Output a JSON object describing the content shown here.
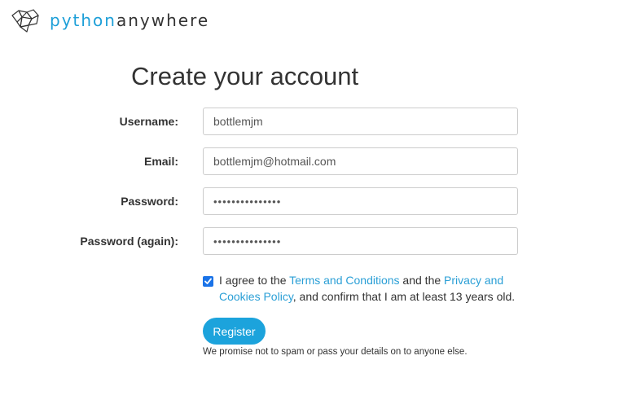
{
  "brand": {
    "name_part1": "python",
    "name_part2": "anywhere",
    "logo_icon": "pythonanywhere-logo-icon",
    "colors": {
      "accent": "#1d9fd8",
      "text": "#333333"
    }
  },
  "page": {
    "title": "Create your account"
  },
  "form": {
    "username": {
      "label": "Username:",
      "value": "bottlemjm"
    },
    "email": {
      "label": "Email:",
      "value": "bottlemjm@hotmail.com"
    },
    "password": {
      "label": "Password:",
      "value": "passwordpasswor"
    },
    "password_again": {
      "label": "Password (again):",
      "value": "passwordpasswor"
    },
    "agree": {
      "checked": true,
      "text_1": "I agree to the ",
      "terms_link": "Terms and Conditions",
      "text_2": " and the ",
      "privacy_link": "Privacy and Cookies Policy",
      "text_3": ", and confirm that I am at least 13 years old."
    },
    "register_label": "Register",
    "promise": "We promise not to spam or pass your details on to anyone else."
  }
}
